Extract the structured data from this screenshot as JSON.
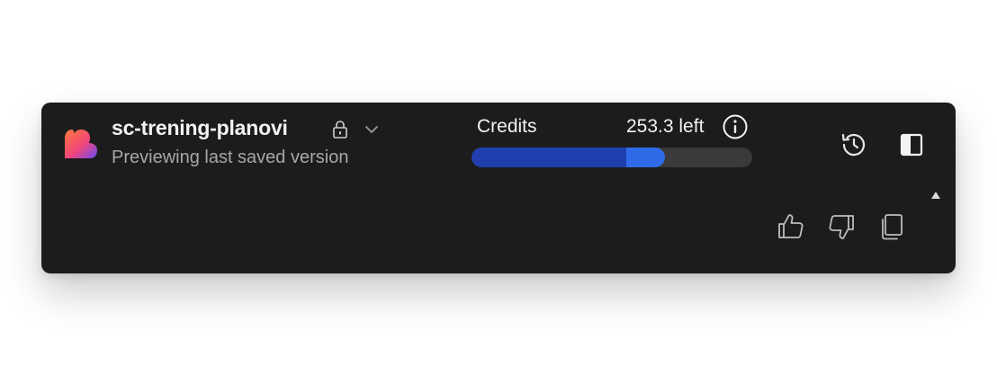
{
  "header": {
    "project_name": "sc-trening-planovi",
    "subtitle": "Previewing last saved version",
    "logo_icon": "heart-logo-icon",
    "lock_icon": "lock-icon",
    "dropdown_icon": "chevron-down-icon"
  },
  "credits": {
    "label": "Credits",
    "remaining_text": "253.3 left",
    "info_icon": "info-icon",
    "used_fraction": 0.55,
    "extra_fraction": 0.14,
    "used_color": "#1f3fae",
    "extra_color": "#2f6be8",
    "track_color": "#3a3a3a"
  },
  "toolbar": {
    "history_icon": "history-icon",
    "sidebar_icon": "sidebar-toggle-icon"
  },
  "feedback": {
    "scroll_icon": "triangle-up-icon",
    "thumbs_up_icon": "thumbs-up-icon",
    "thumbs_down_icon": "thumbs-down-icon",
    "copy_icon": "copy-icon"
  },
  "colors": {
    "panel_background": "#1c1c1c",
    "primary_text": "#f2f2f2",
    "secondary_text": "#a7a7a7"
  }
}
